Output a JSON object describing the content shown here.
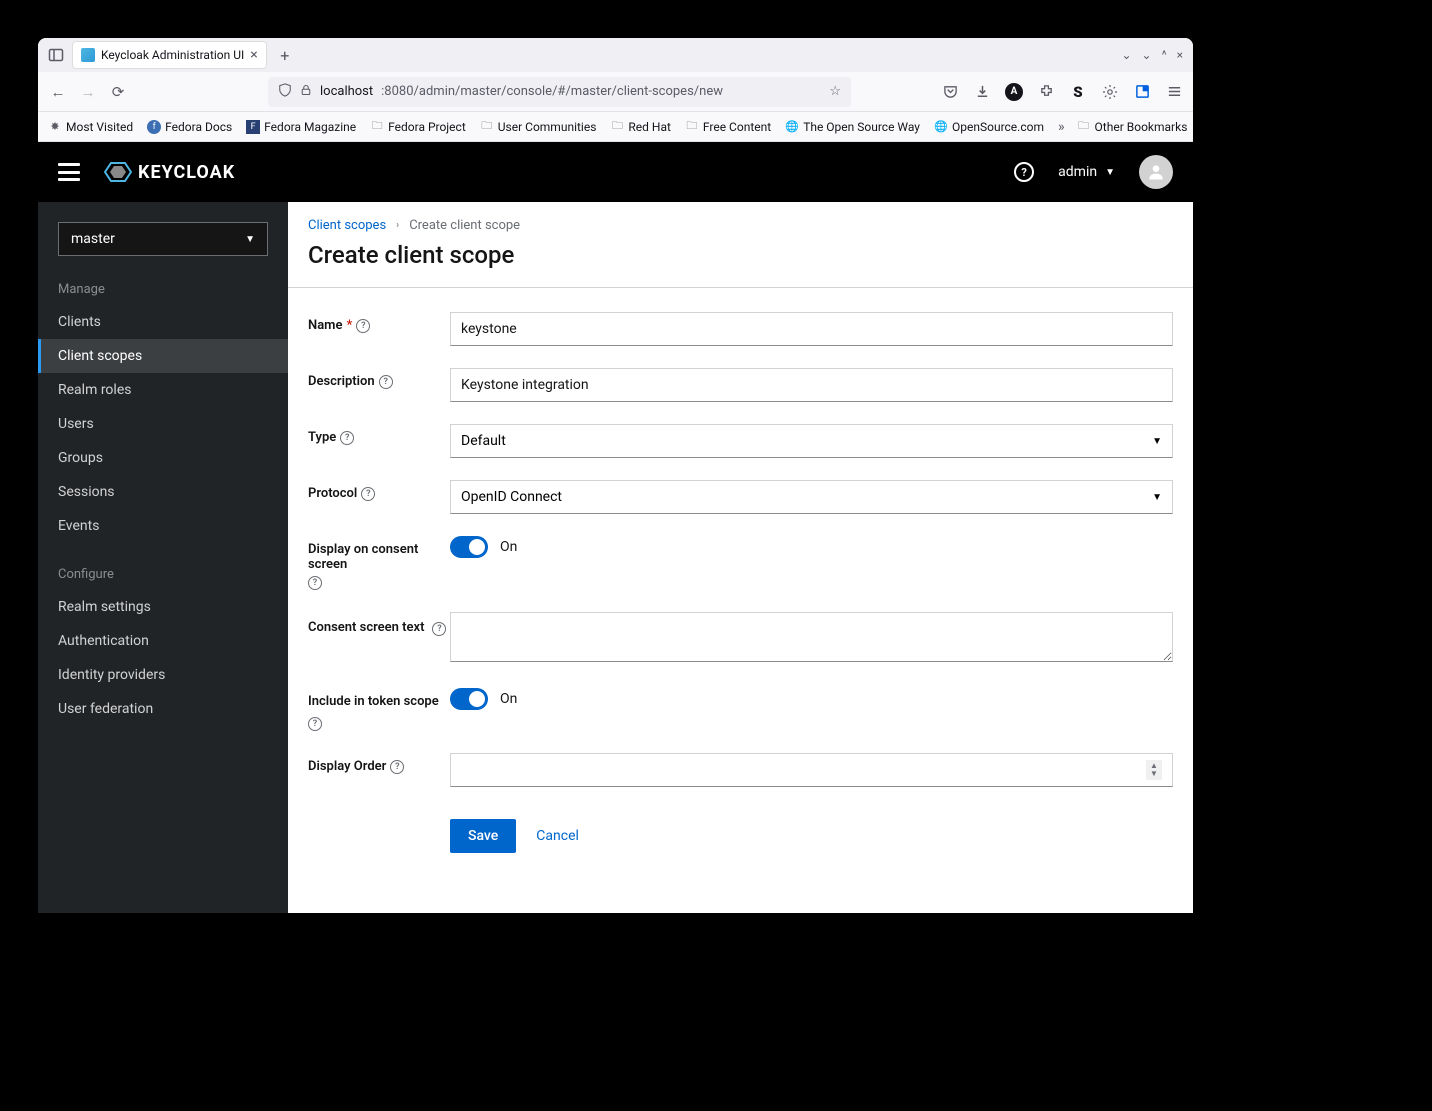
{
  "browser": {
    "tab_title": "Keycloak Administration UI",
    "url_host": "localhost",
    "url_port_path": ":8080/admin/master/console/#/master/client-scopes/new",
    "bookmarks": [
      "Most Visited",
      "Fedora Docs",
      "Fedora Magazine",
      "Fedora Project",
      "User Communities",
      "Red Hat",
      "Free Content",
      "The Open Source Way",
      "OpenSource.com"
    ],
    "other_bookmarks": "Other Bookmarks"
  },
  "header": {
    "brand": "KEYCLOAK",
    "user": "admin"
  },
  "sidebar": {
    "realm": "master",
    "manage_label": "Manage",
    "configure_label": "Configure",
    "manage_items": [
      "Clients",
      "Client scopes",
      "Realm roles",
      "Users",
      "Groups",
      "Sessions",
      "Events"
    ],
    "configure_items": [
      "Realm settings",
      "Authentication",
      "Identity providers",
      "User federation"
    ],
    "active": "Client scopes"
  },
  "breadcrumb": {
    "parent": "Client scopes",
    "current": "Create client scope"
  },
  "page": {
    "title": "Create client scope"
  },
  "form": {
    "name_label": "Name",
    "name_value": "keystone",
    "description_label": "Description",
    "description_value": "Keystone integration",
    "type_label": "Type",
    "type_value": "Default",
    "protocol_label": "Protocol",
    "protocol_value": "OpenID Connect",
    "display_consent_label": "Display on consent screen",
    "display_consent_on": "On",
    "consent_text_label": "Consent screen text",
    "consent_text_value": "",
    "include_token_label": "Include in token scope",
    "include_token_on": "On",
    "display_order_label": "Display Order",
    "display_order_value": "",
    "save": "Save",
    "cancel": "Cancel"
  }
}
